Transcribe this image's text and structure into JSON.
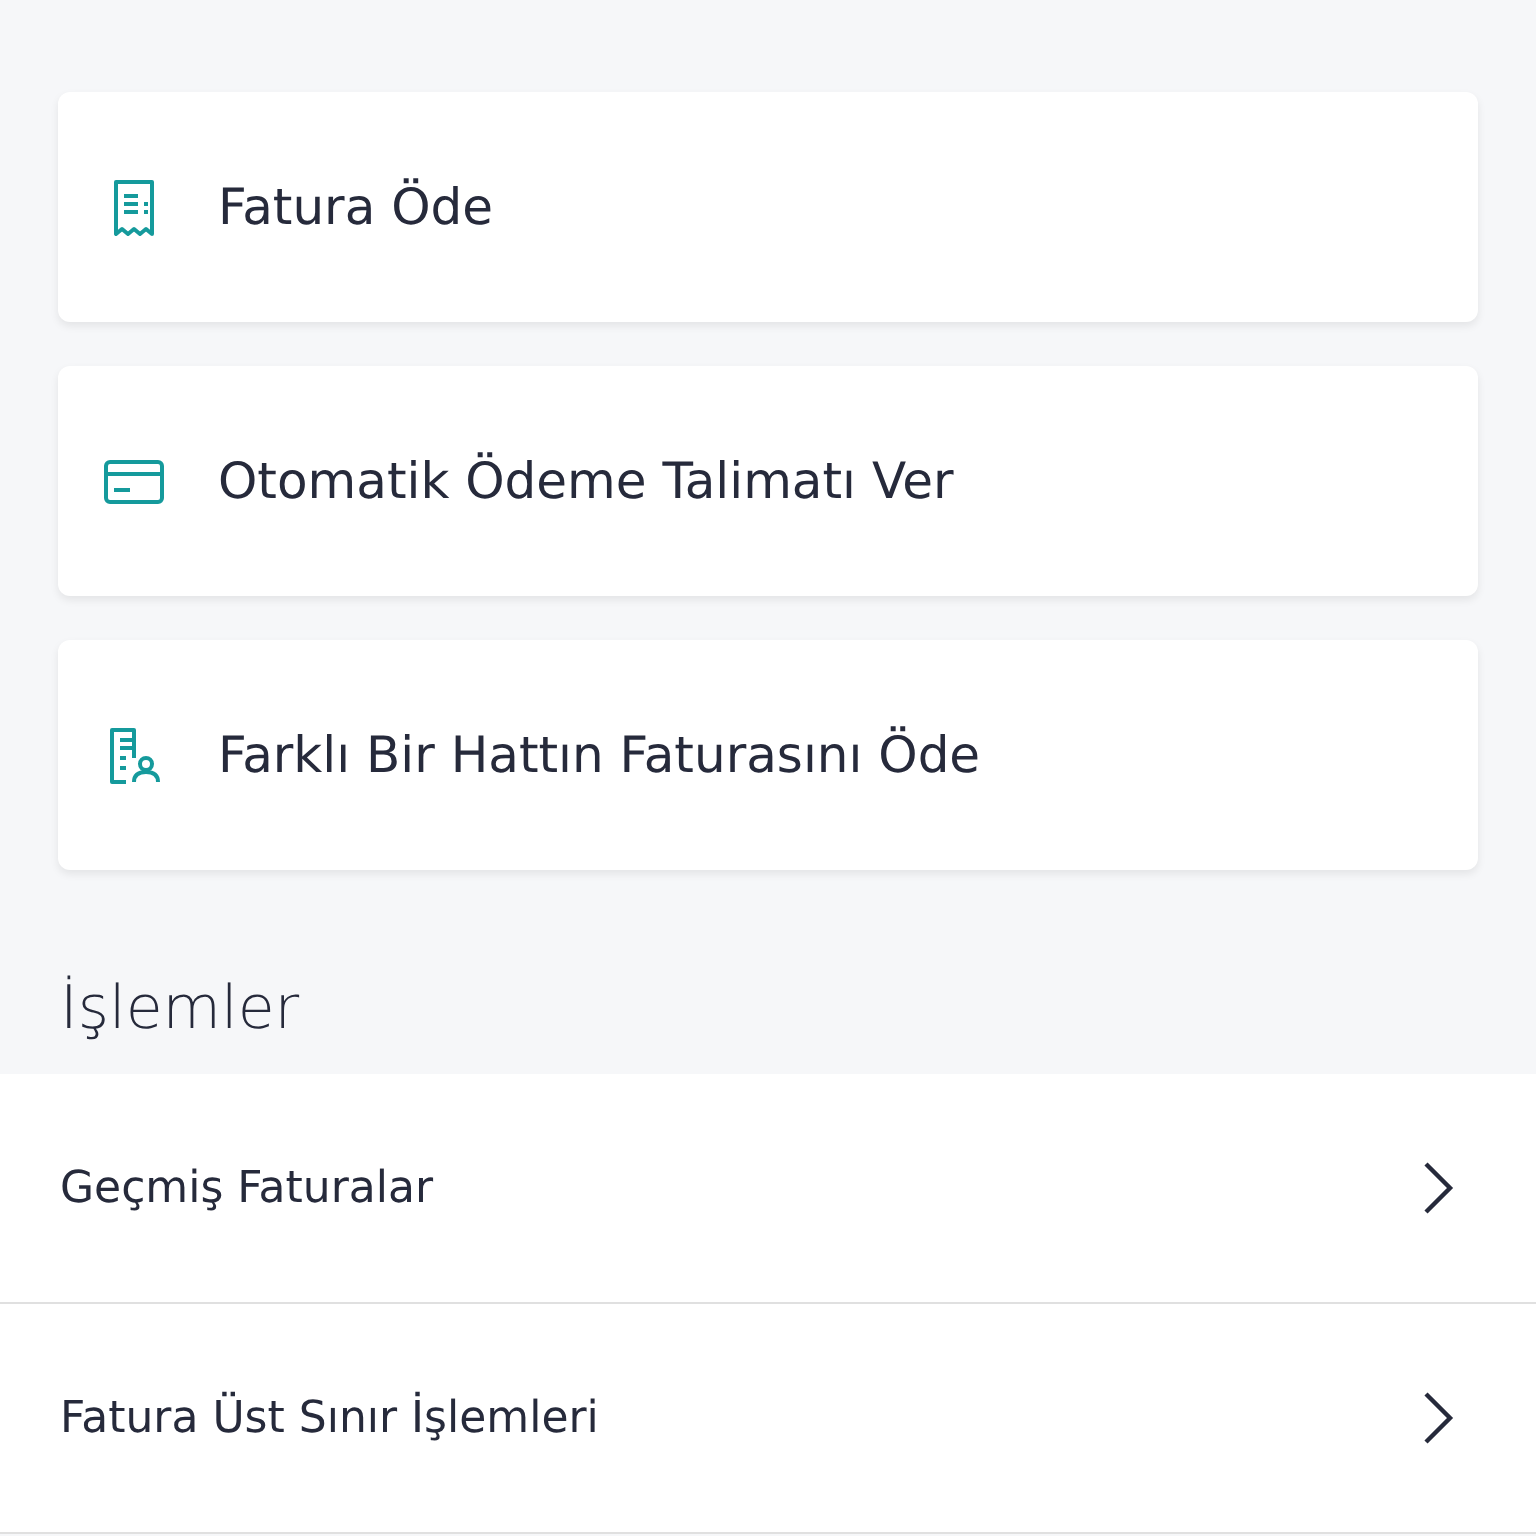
{
  "actions": [
    {
      "kind": "receipt",
      "label": "Fatura Öde"
    },
    {
      "kind": "card",
      "label": "Otomatik Ödeme Talimatı Ver"
    },
    {
      "kind": "receipt-person",
      "label": "Farklı Bir Hattın Faturasını Öde"
    }
  ],
  "section": {
    "title": "İşlemler",
    "items": [
      {
        "label": "Geçmiş Faturalar"
      },
      {
        "label": "Fatura Üst Sınır İşlemleri"
      }
    ]
  }
}
